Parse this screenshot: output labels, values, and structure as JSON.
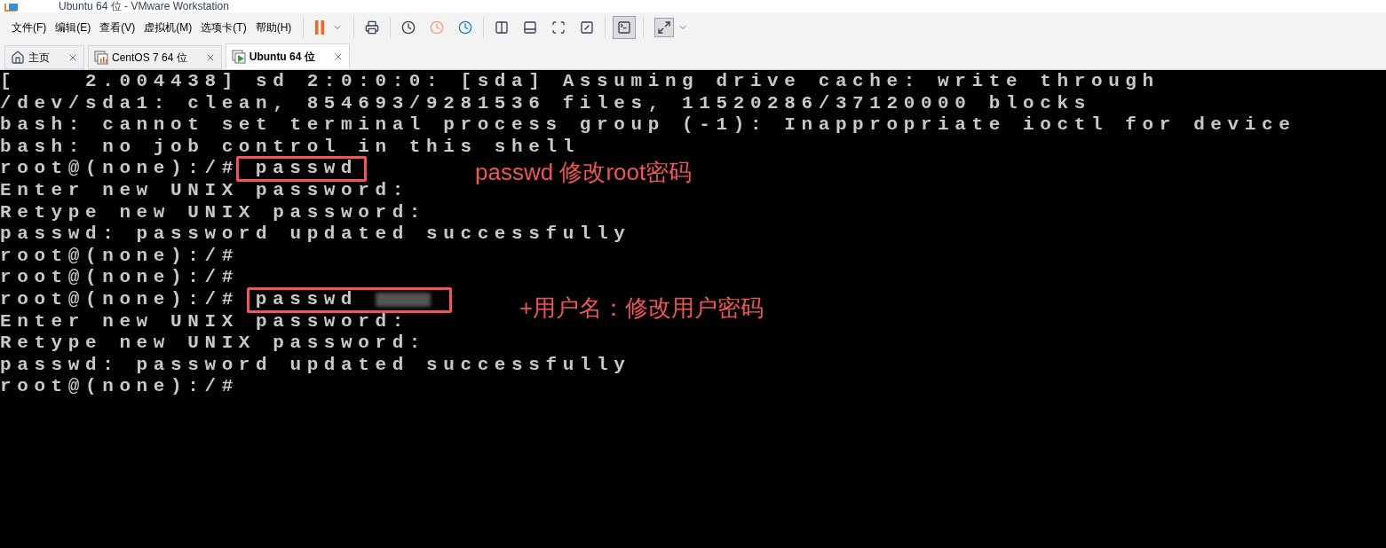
{
  "window": {
    "title": "Ubuntu 64 位 - VMware Workstation"
  },
  "menu": [
    "文件(F)",
    "编辑(E)",
    "查看(V)",
    "虚拟机(M)",
    "选项卡(T)",
    "帮助(H)"
  ],
  "tabs": [
    {
      "kind": "home",
      "label": "主页",
      "selected": false
    },
    {
      "kind": "vm-off",
      "label": "CentOS 7 64 位",
      "selected": false
    },
    {
      "kind": "vm-on",
      "label": "Ubuntu 64 位",
      "selected": true
    }
  ],
  "terminal": {
    "lines": [
      {
        "text": "[    2.004438] sd 2:0:0:0: [sda] Assuming drive cache: write through"
      },
      {
        "text": "/dev/sda1: clean, 854693/9281536 files, 11520286/37120000 blocks"
      },
      {
        "text": "bash: cannot set terminal process group (-1): Inappropriate ioctl for device"
      },
      {
        "text": "bash: no job control in this shell"
      },
      {
        "text": "root@(none):/#",
        "command": "passwd",
        "highlighted": true,
        "redacted": false,
        "note": "passwd 修改root密码"
      },
      {
        "text": "Enter new UNIX password:"
      },
      {
        "text": "Retype new UNIX password:"
      },
      {
        "text": "passwd: password updated successfully"
      },
      {
        "text": "root@(none):/#"
      },
      {
        "text": "root@(none):/#"
      },
      {
        "text": "root@(none):/#",
        "command": "passwd",
        "highlighted": true,
        "redacted": true,
        "note": "+用户名：修改用户密码"
      },
      {
        "text": "Enter new UNIX password:"
      },
      {
        "text": "Retype new UNIX password:"
      },
      {
        "text": "passwd: password updated successfully"
      },
      {
        "text": "root@(none):/#"
      }
    ]
  }
}
